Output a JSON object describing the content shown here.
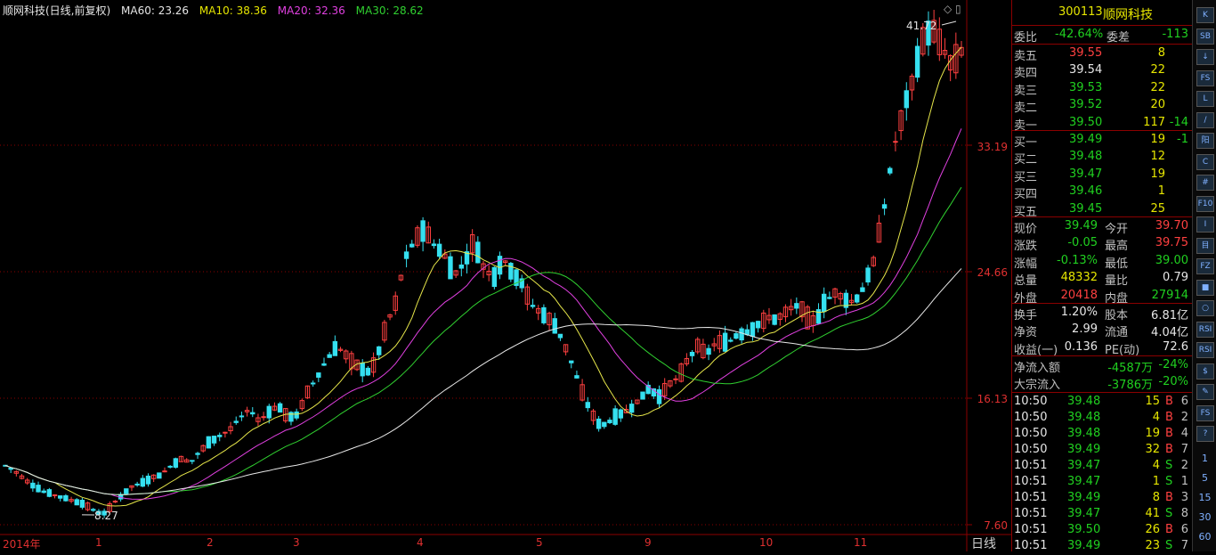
{
  "header": {
    "title": "顺网科技(日线,前复权)",
    "ma60": "MA60: 23.26",
    "ma10": "MA10: 38.36",
    "ma20": "MA20: 32.36",
    "ma30": "MA30: 28.62"
  },
  "colors": {
    "up": "#ff4040",
    "down": "#35e0f0",
    "ma10": "#e6e64a",
    "ma20": "#e040e0",
    "ma30": "#30d030",
    "ma60": "#e8e8e8"
  },
  "y_axis": [
    "33.19",
    "24.66",
    "16.13",
    "7.60"
  ],
  "x_axis": {
    "year": "2014年",
    "months": [
      "1",
      "2",
      "3",
      "4",
      "5",
      "9",
      "10",
      "11"
    ]
  },
  "annotations": {
    "high": "41.72",
    "low": "8.27"
  },
  "period_label": "日线",
  "chart_data": {
    "type": "candlestick",
    "title": "顺网科技(日线,前复权)",
    "ylim": [
      7.6,
      41.72
    ],
    "y_ticks": [
      7.6,
      16.13,
      24.66,
      33.19
    ],
    "x_ticks": [
      "2014年",
      "1",
      "2",
      "3",
      "4",
      "5",
      "9",
      "10",
      "11"
    ],
    "series": [
      {
        "name": "MA60",
        "last": 23.26
      },
      {
        "name": "MA10",
        "last": 38.36
      },
      {
        "name": "MA20",
        "last": 32.36
      },
      {
        "name": "MA30",
        "last": 28.62
      }
    ],
    "price_path": [
      11.6,
      11.2,
      10.6,
      10.2,
      9.8,
      9.6,
      9.4,
      9.2,
      9.0,
      8.6,
      8.27,
      9.0,
      9.6,
      10.2,
      10.4,
      10.8,
      11.0,
      11.6,
      12.0,
      11.8,
      12.6,
      13.2,
      13.6,
      14.0,
      14.8,
      15.4,
      14.6,
      15.2,
      15.6,
      14.8,
      15.0,
      16.6,
      17.6,
      18.8,
      19.6,
      19.0,
      18.4,
      17.8,
      18.6,
      21.0,
      22.6,
      25.6,
      26.8,
      27.6,
      26.4,
      25.8,
      24.4,
      25.2,
      26.8,
      25.0,
      24.2,
      25.6,
      24.6,
      23.8,
      22.4,
      21.8,
      21.4,
      20.2,
      18.6,
      16.8,
      15.2,
      14.2,
      14.6,
      15.0,
      15.4,
      16.0,
      16.8,
      16.2,
      17.0,
      17.6,
      18.8,
      19.6,
      19.2,
      20.0,
      19.8,
      20.4,
      20.6,
      21.0,
      21.6,
      21.4,
      22.0,
      22.4,
      21.8,
      21.2,
      22.6,
      23.2,
      22.8,
      22.6,
      23.6,
      25.4,
      28.6,
      32.8,
      35.4,
      37.6,
      40.2,
      41.2,
      39.8,
      38.6,
      39.49
    ]
  },
  "side": {
    "code": "300113",
    "name": "顺网科技",
    "weibi_label": "委比",
    "weibi": "-42.64%",
    "weicha_label": "委差",
    "weicha": "-113",
    "asks": [
      {
        "label": "卖五",
        "price": "39.55",
        "vol": "8",
        "chg": ""
      },
      {
        "label": "卖四",
        "price": "39.54",
        "vol": "22",
        "chg": ""
      },
      {
        "label": "卖三",
        "price": "39.53",
        "vol": "22",
        "chg": ""
      },
      {
        "label": "卖二",
        "price": "39.52",
        "vol": "20",
        "chg": ""
      },
      {
        "label": "卖一",
        "price": "39.50",
        "vol": "117",
        "chg": "-14"
      }
    ],
    "bids": [
      {
        "label": "买一",
        "price": "39.49",
        "vol": "19",
        "chg": "-1"
      },
      {
        "label": "买二",
        "price": "39.48",
        "vol": "12",
        "chg": ""
      },
      {
        "label": "买三",
        "price": "39.47",
        "vol": "19",
        "chg": ""
      },
      {
        "label": "买四",
        "price": "39.46",
        "vol": "1",
        "chg": ""
      },
      {
        "label": "买五",
        "price": "39.45",
        "vol": "25",
        "chg": ""
      }
    ],
    "quote": [
      {
        "l1": "现价",
        "v1": "39.49",
        "l2": "今开",
        "v2": "39.70"
      },
      {
        "l1": "涨跌",
        "v1": "-0.05",
        "l2": "最高",
        "v2": "39.75"
      },
      {
        "l1": "涨幅",
        "v1": "-0.13%",
        "l2": "最低",
        "v2": "39.00"
      },
      {
        "l1": "总量",
        "v1": "48332",
        "l2": "量比",
        "v2": "0.79"
      },
      {
        "l1": "外盘",
        "v1": "20418",
        "l2": "内盘",
        "v2": "27914"
      }
    ],
    "fin": [
      {
        "l1": "换手",
        "v1": "1.20%",
        "l2": "股本",
        "v2": "6.81亿"
      },
      {
        "l1": "净资",
        "v1": "2.99",
        "l2": "流通",
        "v2": "4.04亿"
      },
      {
        "l1": "收益(一)",
        "v1": "0.136",
        "l2": "PE(动)",
        "v2": "72.6"
      }
    ],
    "flow": [
      {
        "label": "净流入额",
        "value": "-4587万",
        "pct": "-24%"
      },
      {
        "label": "大宗流入",
        "value": "-3786万",
        "pct": "-20%"
      }
    ],
    "ticks": [
      {
        "time": "10:50",
        "price": "39.48",
        "vol": "15",
        "bs": "B",
        "n": "6"
      },
      {
        "time": "10:50",
        "price": "39.48",
        "vol": "4",
        "bs": "B",
        "n": "2"
      },
      {
        "time": "10:50",
        "price": "39.48",
        "vol": "19",
        "bs": "B",
        "n": "4"
      },
      {
        "time": "10:50",
        "price": "39.49",
        "vol": "32",
        "bs": "B",
        "n": "7"
      },
      {
        "time": "10:51",
        "price": "39.47",
        "vol": "4",
        "bs": "S",
        "n": "2"
      },
      {
        "time": "10:51",
        "price": "39.47",
        "vol": "1",
        "bs": "S",
        "n": "1"
      },
      {
        "time": "10:51",
        "price": "39.49",
        "vol": "8",
        "bs": "B",
        "n": "3"
      },
      {
        "time": "10:51",
        "price": "39.47",
        "vol": "41",
        "bs": "S",
        "n": "8"
      },
      {
        "time": "10:51",
        "price": "39.50",
        "vol": "26",
        "bs": "B",
        "n": "6"
      },
      {
        "time": "10:51",
        "price": "39.49",
        "vol": "23",
        "bs": "S",
        "n": "7"
      }
    ]
  },
  "toolbar": {
    "buttons": [
      "K",
      "SB",
      "↓",
      "FS",
      "L",
      "/",
      "阳",
      "C",
      "#",
      "F10",
      "I",
      "目",
      "FZ",
      "■",
      "○",
      "RSI",
      "RSI",
      "$",
      "✎",
      "FS",
      "?"
    ],
    "numbers": [
      "1",
      "5",
      "15",
      "30",
      "60"
    ]
  }
}
